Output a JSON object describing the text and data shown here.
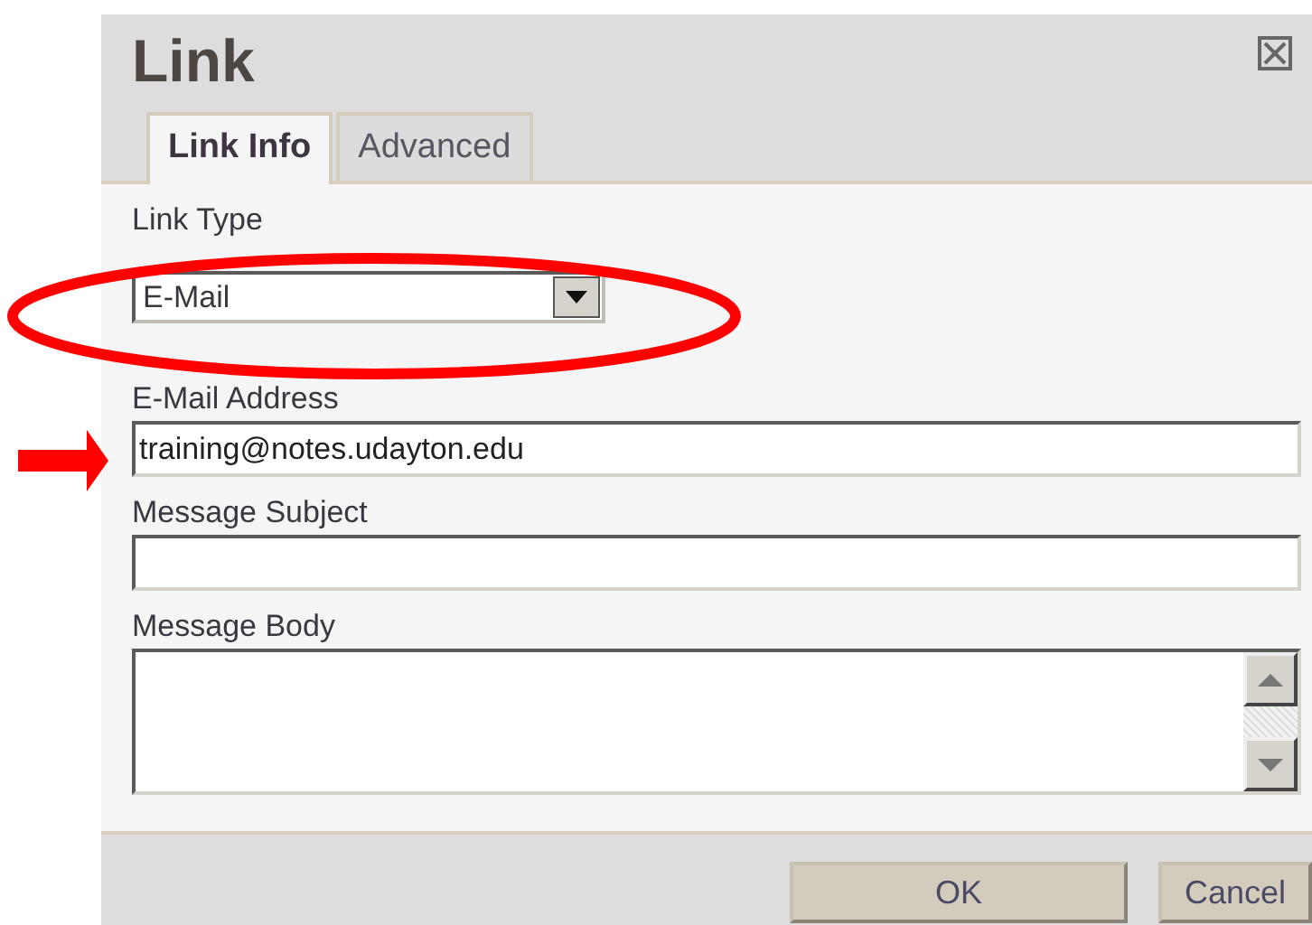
{
  "dialog": {
    "title": "Link",
    "tabs": [
      {
        "label": "Link Info",
        "selected": true
      },
      {
        "label": "Advanced",
        "selected": false
      }
    ],
    "link_type": {
      "label": "Link Type",
      "value": "E-Mail"
    },
    "fields": [
      {
        "kind": "input",
        "label": "E-Mail Address",
        "value": "training@notes.udayton.edu"
      },
      {
        "kind": "input",
        "label": "Message Subject"
      },
      {
        "kind": "textarea",
        "label": "Message Body"
      }
    ],
    "buttons": [
      {
        "label": "OK",
        "kind": "wide"
      },
      {
        "label": "Cancel",
        "kind": "narrow"
      }
    ]
  }
}
